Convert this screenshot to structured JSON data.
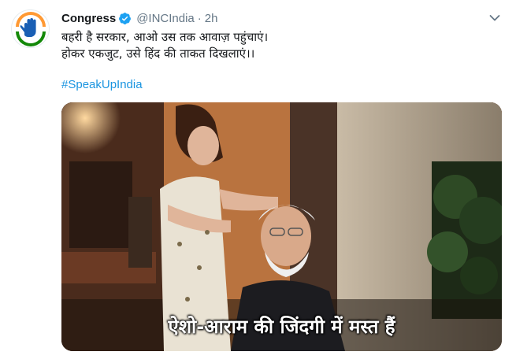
{
  "tweet": {
    "author_name": "Congress",
    "author_handle": "@INCIndia",
    "separator": "·",
    "timestamp": "2h",
    "text_lines": [
      "बहरी है सरकार, आओ उस तक आवाज़ पहुंचाएं।",
      "होकर एकजुट, उसे हिंद की ताकत दिखलाएं।।"
    ],
    "hashtag": "#SpeakUpIndia",
    "video_caption": "ऐशो-आराम की जिंदगी में मस्त हैं"
  },
  "icons": {
    "avatar": "congress-hand-logo",
    "verified": "verified-badge-icon",
    "menu": "chevron-down-icon"
  },
  "colors": {
    "link": "#1b95e0",
    "verified": "#1da1f2",
    "secondary_text": "#657786",
    "logo_saffron": "#ff9933",
    "logo_green": "#138808"
  }
}
